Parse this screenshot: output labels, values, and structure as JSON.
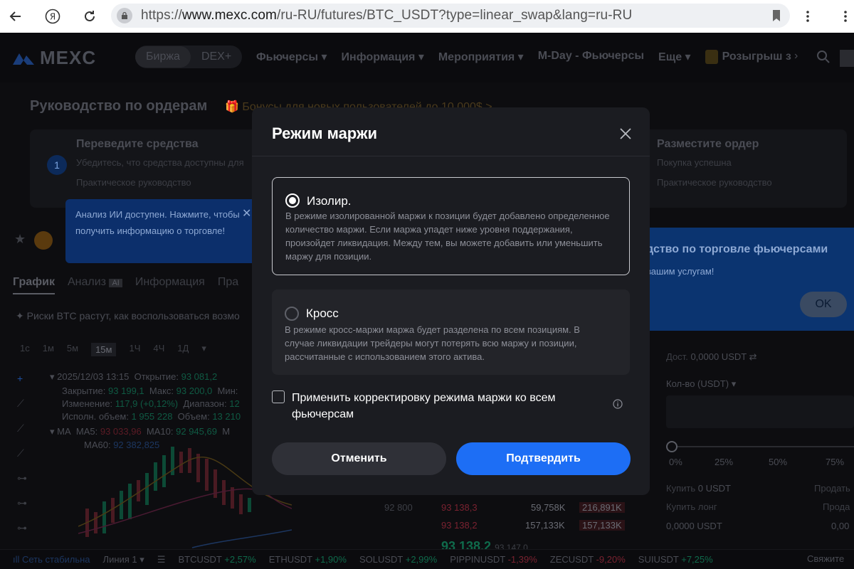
{
  "browser": {
    "url_prefix": "https://",
    "url_domain": "www.mexc.com",
    "url_path": "/ru-RU/futures/BTC_USDT?type=linear_swap&lang=ru-RU"
  },
  "nav": {
    "logo": "MEXC",
    "pill_items": [
      "Биржа",
      "DEX+"
    ],
    "links": [
      "Фьючерсы ▾",
      "Информация ▾",
      "Мероприятия ▾",
      "M-Day - Фьючерсы",
      "Еще ▾",
      "Розыгрыш з"
    ]
  },
  "background": {
    "guide_title": "Руководство по ордерам",
    "guide_bonus": "Бонусы для новых пользователей до 10 000$ >",
    "step1": {
      "num": "1",
      "title": "Переведите средства",
      "desc": "Убедитесь, что средства доступны для",
      "link": "Практическое руководство"
    },
    "step3": {
      "title": "Разместите ордер",
      "desc": "Покупка успешна",
      "link": "Практическое руководство"
    },
    "ai_tip": "Анализ ИИ доступен. Нажмите, чтобы получить информацию о торговле!",
    "banner_title": "дство по торговле фьючерсами",
    "banner_sub": "вашим услугам!",
    "banner_ok": "OK",
    "tabs": [
      "График",
      "Анализ",
      "Информация",
      "Пра"
    ],
    "risk_text": "Риски BTC растут, как воспользоваться возмо",
    "intervals": [
      "1с",
      "1м",
      "5м",
      "15м",
      "1Ч",
      "4Ч",
      "1Д",
      "▾"
    ],
    "ohlc": {
      "date": "2025/12/03 13:15",
      "open_label": "Открытие:",
      "open": "93 081,2",
      "close_label": "Закрытие:",
      "close": "93 199,1",
      "max_label": "Макс:",
      "max": "93 200,0",
      "min_label": "Мин:",
      "change_label": "Изменение:",
      "change": "117,9 (+0,12%)",
      "range_label": "Диапазон:",
      "range": "12",
      "exec_label": "Исполн. объем:",
      "exec": "1 955 228",
      "vol_label": "Объем:",
      "vol": "13 210"
    },
    "ma": {
      "label": "MA",
      "ma5_label": "MA5:",
      "ma5": "93 033,96",
      "ma10_label": "MA10:",
      "ma10": "92 945,69",
      "ma_cut": "M",
      "ma60_label": "MA60:",
      "ma60": "92 382,825"
    },
    "price_axis": "92 800",
    "orderbook": [
      {
        "price": "93 138,3",
        "qty": "59,758K",
        "total": "216,891K"
      },
      {
        "price": "93 138,2",
        "qty": "157,133K",
        "total": "157,133K"
      }
    ],
    "last_price": "93 138,2",
    "last_price_sub": "93 147,0",
    "right": {
      "avail_label": "Дост.",
      "avail_value": "0,0000 USDT",
      "qty_label": "Кол-во (USDT)",
      "percents": [
        "0%",
        "25%",
        "50%",
        "75%"
      ],
      "buy_label": "Купить",
      "buy_value": "0 USDT",
      "sell_label": "Продать",
      "buy_long": "Купить лонг",
      "sell_cut": "Прода",
      "amount": "0,0000 USDT",
      "amount_cut": "0,00"
    },
    "ticker": [
      {
        "sym": "Сеть стабильна",
        "chg": "",
        "dir": "up"
      },
      {
        "sym": "Линия 1 ▾",
        "chg": "",
        "dir": "none"
      },
      {
        "sym": "BTCUSDT",
        "chg": "+2,57%",
        "dir": "up"
      },
      {
        "sym": "ETHUSDT",
        "chg": "+1,90%",
        "dir": "up"
      },
      {
        "sym": "SOLUSDT",
        "chg": "+2,99%",
        "dir": "up"
      },
      {
        "sym": "PIPPINUSDT",
        "chg": "-1,39%",
        "dir": "dn"
      },
      {
        "sym": "ZECUSDT",
        "chg": "-9,20%",
        "dir": "dn"
      },
      {
        "sym": "SUIUSDT",
        "chg": "+7,25%",
        "dir": "up"
      }
    ],
    "ticker_right": "Свяжите"
  },
  "modal": {
    "title": "Режим маржи",
    "isolated": {
      "label": "Изолир.",
      "desc": "В режиме изолированной маржи к позиции будет добавлено определенное количество маржи. Если маржа упадет ниже уровня поддержания, произойдет ликвидация. Между тем, вы можете добавить или уменьшить маржу для позиции.",
      "selected": true
    },
    "cross": {
      "label": "Кросс",
      "desc": "В режиме кросс-маржи маржа будет разделена по всем позициям. В случае ликвидации трейдеры могут потерять всю маржу и позиции, рассчитанные с использованием этого актива.",
      "selected": false
    },
    "apply_all": {
      "label": "Применить корректировку режима маржи ко всем фьючерсам",
      "checked": false
    },
    "cancel_label": "Отменить",
    "confirm_label": "Подтвердить"
  },
  "colors": {
    "accent": "#1d6ef5",
    "modal_bg": "#1b1c21",
    "up": "#0f6a4b",
    "down": "#7a2230"
  }
}
